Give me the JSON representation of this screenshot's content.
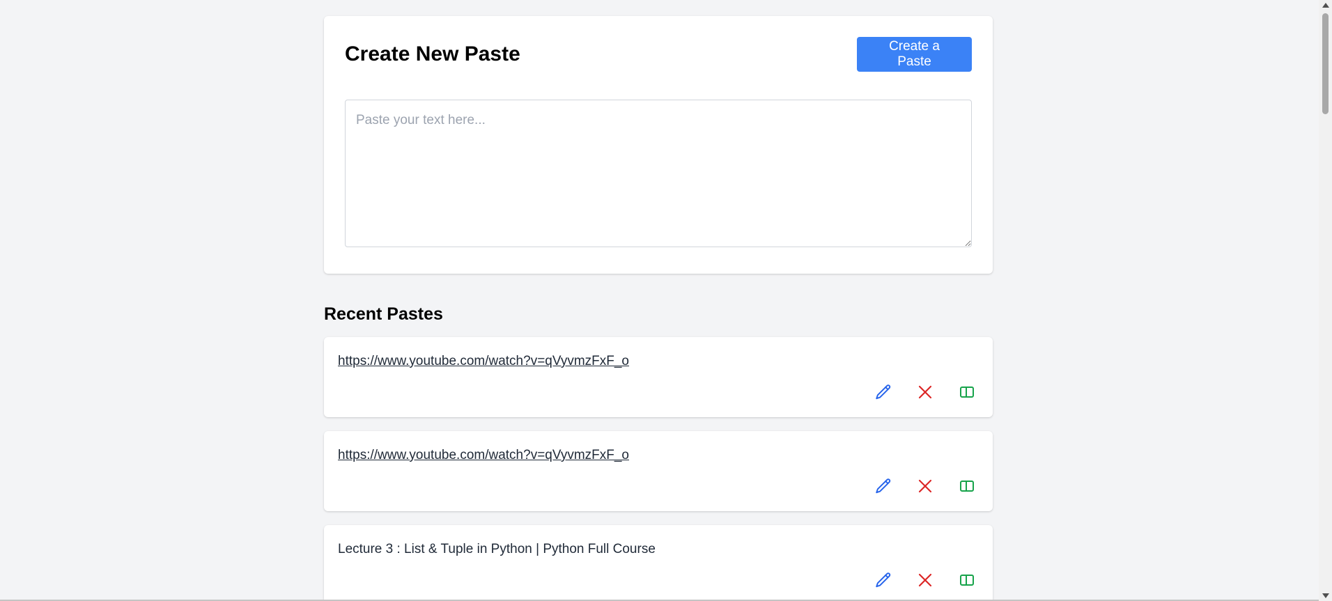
{
  "create": {
    "title": "Create New Paste",
    "button_label": "Create a Paste",
    "textarea_value": "",
    "textarea_placeholder": "Paste your text here..."
  },
  "recent": {
    "title": "Recent Pastes",
    "items": [
      {
        "text": "https://www.youtube.com/watch?v=qVyvmzFxF_o",
        "is_link": true
      },
      {
        "text": "https://www.youtube.com/watch?v=qVyvmzFxF_o",
        "is_link": true
      },
      {
        "text": "Lecture 3 : List & Tuple in Python | Python Full Course",
        "is_link": false
      }
    ],
    "actions": [
      {
        "icon": "pencil-icon",
        "color": "#2563eb"
      },
      {
        "icon": "close-icon",
        "color": "#dc2626"
      },
      {
        "icon": "copy-icon",
        "color": "#16a34a"
      }
    ]
  },
  "colors": {
    "accent": "#3b82f6",
    "background": "#f3f4f6",
    "edit": "#2563eb",
    "delete": "#dc2626",
    "copy": "#16a34a"
  }
}
